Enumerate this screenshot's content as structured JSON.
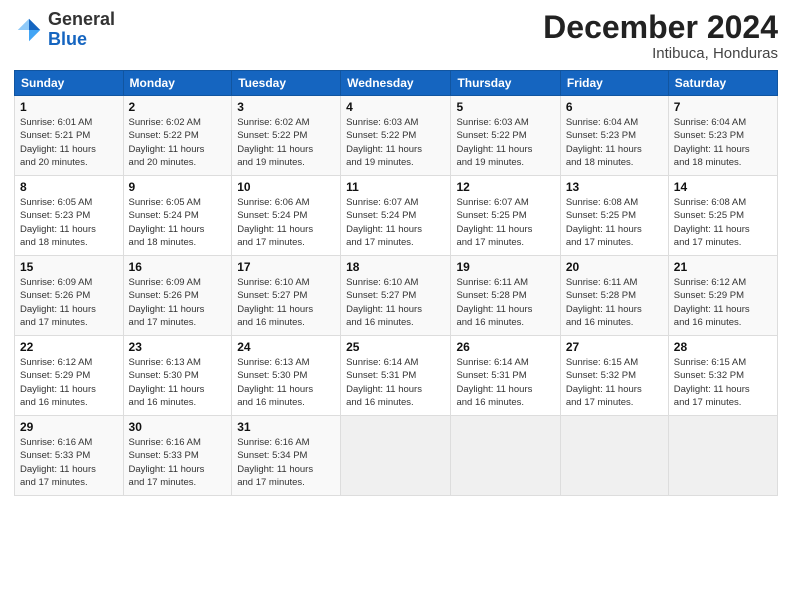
{
  "logo": {
    "general": "General",
    "blue": "Blue"
  },
  "header": {
    "month": "December 2024",
    "location": "Intibuca, Honduras"
  },
  "weekdays": [
    "Sunday",
    "Monday",
    "Tuesday",
    "Wednesday",
    "Thursday",
    "Friday",
    "Saturday"
  ],
  "weeks": [
    [
      {
        "day": "1",
        "info": "Sunrise: 6:01 AM\nSunset: 5:21 PM\nDaylight: 11 hours\nand 20 minutes."
      },
      {
        "day": "2",
        "info": "Sunrise: 6:02 AM\nSunset: 5:22 PM\nDaylight: 11 hours\nand 20 minutes."
      },
      {
        "day": "3",
        "info": "Sunrise: 6:02 AM\nSunset: 5:22 PM\nDaylight: 11 hours\nand 19 minutes."
      },
      {
        "day": "4",
        "info": "Sunrise: 6:03 AM\nSunset: 5:22 PM\nDaylight: 11 hours\nand 19 minutes."
      },
      {
        "day": "5",
        "info": "Sunrise: 6:03 AM\nSunset: 5:22 PM\nDaylight: 11 hours\nand 19 minutes."
      },
      {
        "day": "6",
        "info": "Sunrise: 6:04 AM\nSunset: 5:23 PM\nDaylight: 11 hours\nand 18 minutes."
      },
      {
        "day": "7",
        "info": "Sunrise: 6:04 AM\nSunset: 5:23 PM\nDaylight: 11 hours\nand 18 minutes."
      }
    ],
    [
      {
        "day": "8",
        "info": "Sunrise: 6:05 AM\nSunset: 5:23 PM\nDaylight: 11 hours\nand 18 minutes."
      },
      {
        "day": "9",
        "info": "Sunrise: 6:05 AM\nSunset: 5:24 PM\nDaylight: 11 hours\nand 18 minutes."
      },
      {
        "day": "10",
        "info": "Sunrise: 6:06 AM\nSunset: 5:24 PM\nDaylight: 11 hours\nand 17 minutes."
      },
      {
        "day": "11",
        "info": "Sunrise: 6:07 AM\nSunset: 5:24 PM\nDaylight: 11 hours\nand 17 minutes."
      },
      {
        "day": "12",
        "info": "Sunrise: 6:07 AM\nSunset: 5:25 PM\nDaylight: 11 hours\nand 17 minutes."
      },
      {
        "day": "13",
        "info": "Sunrise: 6:08 AM\nSunset: 5:25 PM\nDaylight: 11 hours\nand 17 minutes."
      },
      {
        "day": "14",
        "info": "Sunrise: 6:08 AM\nSunset: 5:25 PM\nDaylight: 11 hours\nand 17 minutes."
      }
    ],
    [
      {
        "day": "15",
        "info": "Sunrise: 6:09 AM\nSunset: 5:26 PM\nDaylight: 11 hours\nand 17 minutes."
      },
      {
        "day": "16",
        "info": "Sunrise: 6:09 AM\nSunset: 5:26 PM\nDaylight: 11 hours\nand 17 minutes."
      },
      {
        "day": "17",
        "info": "Sunrise: 6:10 AM\nSunset: 5:27 PM\nDaylight: 11 hours\nand 16 minutes."
      },
      {
        "day": "18",
        "info": "Sunrise: 6:10 AM\nSunset: 5:27 PM\nDaylight: 11 hours\nand 16 minutes."
      },
      {
        "day": "19",
        "info": "Sunrise: 6:11 AM\nSunset: 5:28 PM\nDaylight: 11 hours\nand 16 minutes."
      },
      {
        "day": "20",
        "info": "Sunrise: 6:11 AM\nSunset: 5:28 PM\nDaylight: 11 hours\nand 16 minutes."
      },
      {
        "day": "21",
        "info": "Sunrise: 6:12 AM\nSunset: 5:29 PM\nDaylight: 11 hours\nand 16 minutes."
      }
    ],
    [
      {
        "day": "22",
        "info": "Sunrise: 6:12 AM\nSunset: 5:29 PM\nDaylight: 11 hours\nand 16 minutes."
      },
      {
        "day": "23",
        "info": "Sunrise: 6:13 AM\nSunset: 5:30 PM\nDaylight: 11 hours\nand 16 minutes."
      },
      {
        "day": "24",
        "info": "Sunrise: 6:13 AM\nSunset: 5:30 PM\nDaylight: 11 hours\nand 16 minutes."
      },
      {
        "day": "25",
        "info": "Sunrise: 6:14 AM\nSunset: 5:31 PM\nDaylight: 11 hours\nand 16 minutes."
      },
      {
        "day": "26",
        "info": "Sunrise: 6:14 AM\nSunset: 5:31 PM\nDaylight: 11 hours\nand 16 minutes."
      },
      {
        "day": "27",
        "info": "Sunrise: 6:15 AM\nSunset: 5:32 PM\nDaylight: 11 hours\nand 17 minutes."
      },
      {
        "day": "28",
        "info": "Sunrise: 6:15 AM\nSunset: 5:32 PM\nDaylight: 11 hours\nand 17 minutes."
      }
    ],
    [
      {
        "day": "29",
        "info": "Sunrise: 6:16 AM\nSunset: 5:33 PM\nDaylight: 11 hours\nand 17 minutes."
      },
      {
        "day": "30",
        "info": "Sunrise: 6:16 AM\nSunset: 5:33 PM\nDaylight: 11 hours\nand 17 minutes."
      },
      {
        "day": "31",
        "info": "Sunrise: 6:16 AM\nSunset: 5:34 PM\nDaylight: 11 hours\nand 17 minutes."
      },
      null,
      null,
      null,
      null
    ]
  ]
}
